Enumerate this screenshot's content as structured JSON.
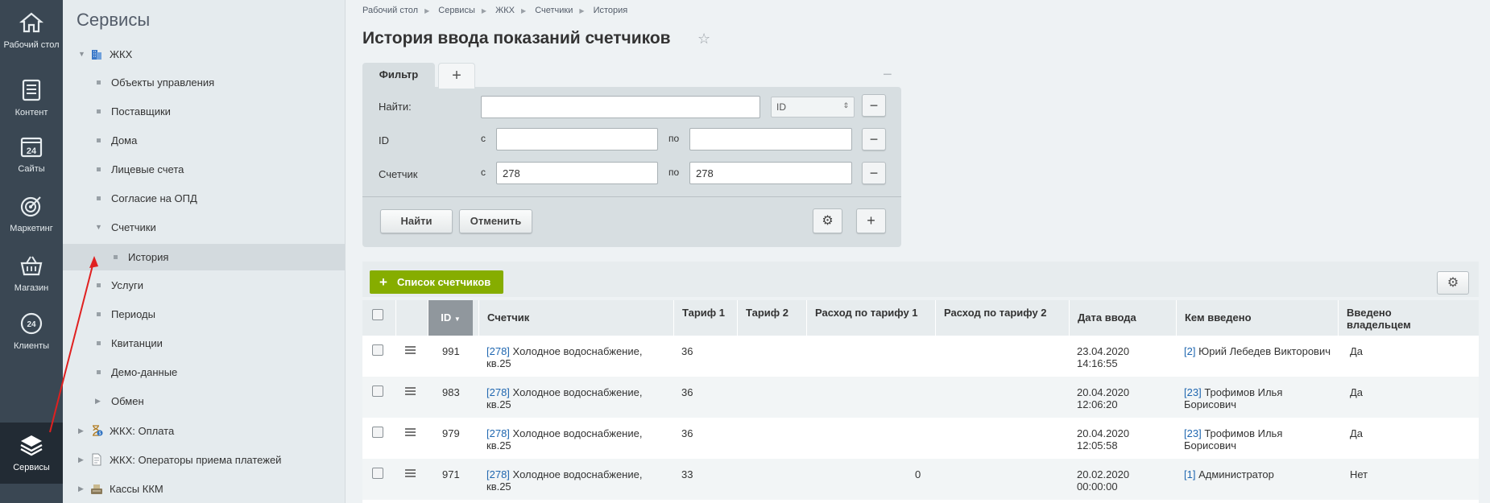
{
  "rail": [
    {
      "label": "Рабочий стол",
      "icon": "home-icon"
    },
    {
      "label": "Контент",
      "icon": "document-icon"
    },
    {
      "label": "Сайты",
      "icon": "calendar-24-icon"
    },
    {
      "label": "Маркетинг",
      "icon": "target-icon"
    },
    {
      "label": "Магазин",
      "icon": "basket-icon"
    },
    {
      "label": "Клиенты",
      "icon": "clients-24-icon"
    },
    {
      "label": "Сервисы",
      "icon": "layers-icon",
      "active": true
    }
  ],
  "menu": {
    "title": "Сервисы",
    "items": [
      {
        "label": "ЖКХ",
        "kind": "group-open"
      },
      {
        "label": "Объекты управления"
      },
      {
        "label": "Поставщики"
      },
      {
        "label": "Дома"
      },
      {
        "label": "Лицевые счета"
      },
      {
        "label": "Согласие на ОПД"
      },
      {
        "label": "Счетчики",
        "kind": "sub-open"
      },
      {
        "label": "История",
        "kind": "child",
        "selected": true
      },
      {
        "label": "Услуги"
      },
      {
        "label": "Периоды"
      },
      {
        "label": "Квитанции"
      },
      {
        "label": "Демо-данные"
      },
      {
        "label": "Обмен",
        "kind": "sub-closed"
      },
      {
        "label": "ЖКХ: Оплата",
        "kind": "group-closed"
      },
      {
        "label": "ЖКХ: Операторы приема платежей",
        "kind": "group-closed"
      },
      {
        "label": "Кассы ККМ",
        "kind": "group-closed"
      }
    ]
  },
  "breadcrumbs": [
    "Рабочий стол",
    "Сервисы",
    "ЖКХ",
    "Счетчики",
    "История"
  ],
  "page": {
    "title": "История ввода показаний счетчиков"
  },
  "filter": {
    "tab_label": "Фильтр",
    "find_label": "Найти:",
    "find_value": "",
    "find_select": "ID",
    "id_label": "ID",
    "from_label": "с",
    "to_label": "по",
    "id_from": "",
    "id_to": "",
    "meter_label": "Счетчик",
    "meter_from": "278",
    "meter_to": "278",
    "find_button": "Найти",
    "cancel_button": "Отменить"
  },
  "list": {
    "add_button": "Список счетчиков",
    "columns": [
      "ID",
      "Счетчик",
      "Тариф 1",
      "Тариф 2",
      "Расход по тарифу 1",
      "Расход по тарифу 2",
      "Дата ввода",
      "Кем введено",
      "Введено владельцем"
    ],
    "rows": [
      {
        "id": "991",
        "meter_id": "[278]",
        "meter": "Холодное водоснабжение, кв.25",
        "t1": "36",
        "t2": "",
        "r1": "",
        "r2": "",
        "date": "23.04.2020",
        "time": "14:16:55",
        "user_id": "[2]",
        "user": "Юрий Лебедев Викторович",
        "owner": "Да"
      },
      {
        "id": "983",
        "meter_id": "[278]",
        "meter": "Холодное водоснабжение, кв.25",
        "t1": "36",
        "t2": "",
        "r1": "",
        "r2": "",
        "date": "20.04.2020",
        "time": "12:06:20",
        "user_id": "[23]",
        "user": "Трофимов Илья Борисович",
        "owner": "Да"
      },
      {
        "id": "979",
        "meter_id": "[278]",
        "meter": "Холодное водоснабжение, кв.25",
        "t1": "36",
        "t2": "",
        "r1": "",
        "r2": "",
        "date": "20.04.2020",
        "time": "12:05:58",
        "user_id": "[23]",
        "user": "Трофимов Илья Борисович",
        "owner": "Да"
      },
      {
        "id": "971",
        "meter_id": "[278]",
        "meter": "Холодное водоснабжение, кв.25",
        "t1": "33",
        "t2": "",
        "r1": "0",
        "r2": "",
        "date": "20.02.2020",
        "time": "00:00:00",
        "user_id": "[1]",
        "user": "Администратор",
        "owner": "Нет"
      }
    ]
  },
  "colors": {
    "rail": "#3a4753",
    "accent_green": "#86ad00",
    "link": "#2067b0",
    "annotation_arrow": "#e02020"
  }
}
